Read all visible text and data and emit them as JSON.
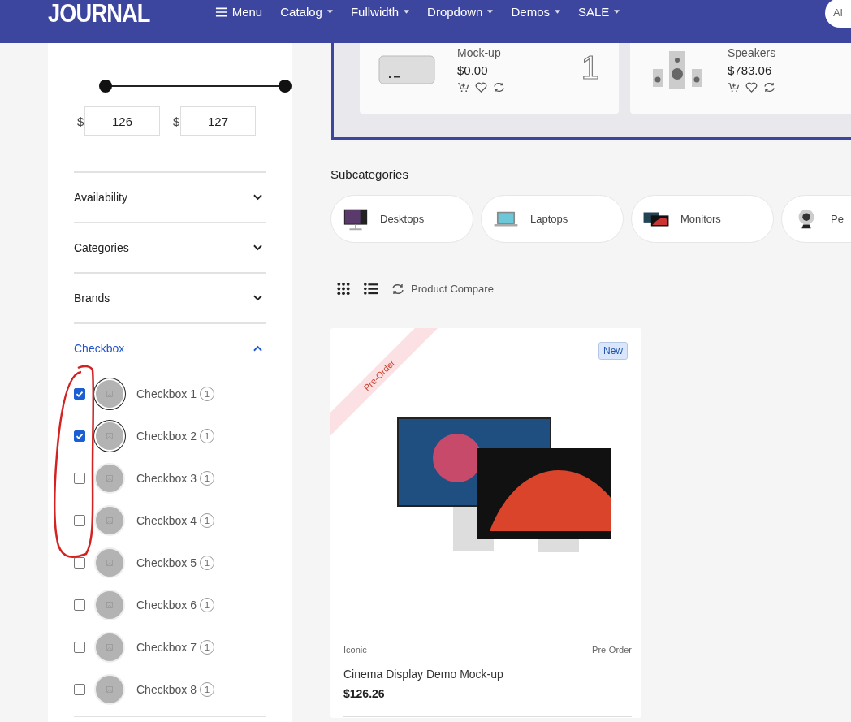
{
  "header": {
    "logo": "JOURNAL",
    "nav": [
      {
        "label": "Menu",
        "kind": "menu"
      },
      {
        "label": "Catalog",
        "kind": "dropdown"
      },
      {
        "label": "Fullwidth",
        "kind": "dropdown"
      },
      {
        "label": "Dropdown",
        "kind": "dropdown"
      },
      {
        "label": "Demos",
        "kind": "dropdown"
      },
      {
        "label": "SALE",
        "kind": "dropdown"
      }
    ],
    "search_text": "Al"
  },
  "sidebar": {
    "price_slider": {
      "handles": [
        {
          "level": 0
        },
        {
          "level": 1
        }
      ]
    },
    "min_price": {
      "currency": "$",
      "value": "126"
    },
    "max_price": {
      "currency": "$",
      "value": "127"
    },
    "sections": [
      {
        "title": "Availability",
        "expanded": false
      },
      {
        "title": "Categories",
        "expanded": false
      },
      {
        "title": "Brands",
        "expanded": false
      },
      {
        "title": "Checkbox",
        "expanded": true,
        "options": [
          {
            "label": "Checkbox 1",
            "count": "1",
            "checked": true
          },
          {
            "label": "Checkbox 2",
            "count": "1",
            "checked": true
          },
          {
            "label": "Checkbox 3",
            "count": "1",
            "checked": false
          },
          {
            "label": "Checkbox 4",
            "count": "1",
            "checked": false
          },
          {
            "label": "Checkbox 5",
            "count": "1",
            "checked": false
          },
          {
            "label": "Checkbox 6",
            "count": "1",
            "checked": false
          },
          {
            "label": "Checkbox 7",
            "count": "1",
            "checked": false
          },
          {
            "label": "Checkbox 8",
            "count": "1",
            "checked": false
          }
        ]
      }
    ]
  },
  "featured": {
    "products": [
      {
        "name": "Mock-up",
        "price": "$0.00",
        "rank": "1",
        "kind": "computer"
      },
      {
        "name": "Speakers",
        "price": "$783.06",
        "kind": "speakers"
      }
    ]
  },
  "subcategories": {
    "title": "Subcategories",
    "items": [
      {
        "label": "Desktops",
        "kind": "desktop"
      },
      {
        "label": "Laptops",
        "kind": "laptop"
      },
      {
        "label": "Monitors",
        "kind": "monitors"
      },
      {
        "label": "Pe",
        "kind": "webcam"
      }
    ]
  },
  "toolbar": {
    "compare_label": "Product Compare"
  },
  "product": {
    "ribbon": "Pre-Order",
    "badge": "New",
    "brand": "Iconic",
    "stock": "Pre-Order",
    "name": "Cinema Display Demo Mock-up",
    "price": "$126.26"
  }
}
